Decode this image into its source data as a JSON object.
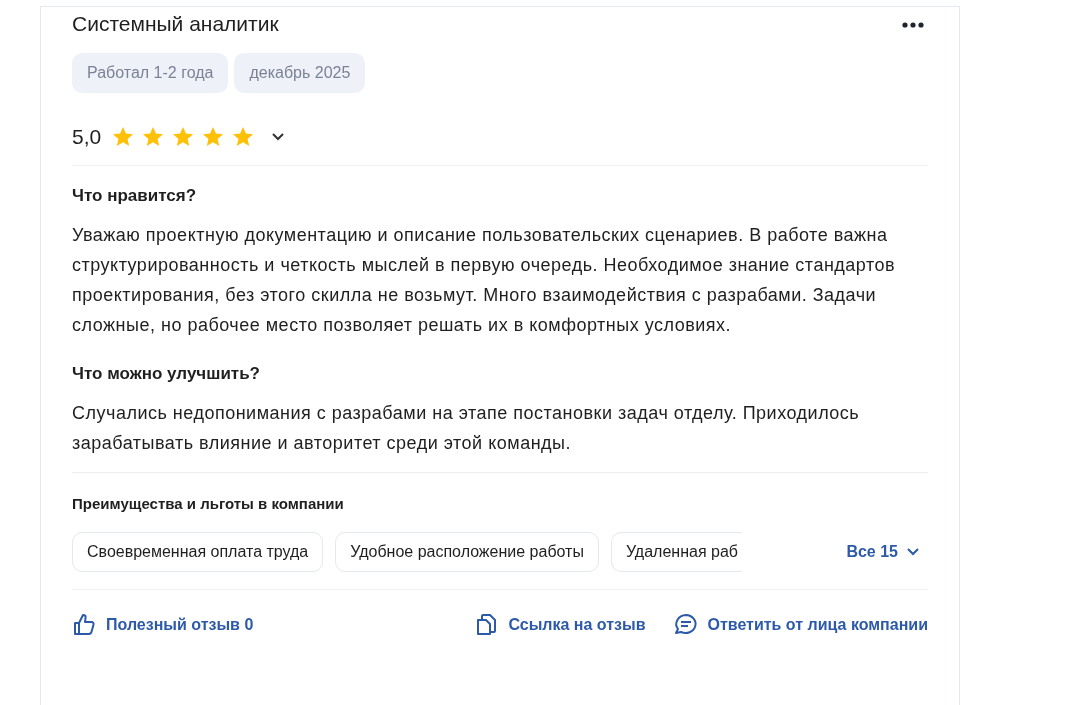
{
  "review": {
    "title": "Системный аналитик",
    "tags": [
      "Работал 1-2 года",
      "декабрь 2025"
    ],
    "rating": "5,0",
    "stars": 5,
    "sections": [
      {
        "heading": "Что нравится?",
        "text": "Уважаю проектную документацию и описание пользовательских сценариев. В работе важна структурированность и четкость мыслей в первую очередь. Необходимое знание стандартов проектирования, без этого скилла не возьмут. Много взаимодействия с разрабами. Задачи сложные, но рабочее место позволяет решать их в комфортных условиях."
      },
      {
        "heading": "Что можно улучшить?",
        "text": "Случались недопонимания с разрабами на этапе постановки задач отделу. Приходилось зарабатывать влияние и авторитет среди этой команды."
      }
    ],
    "benefits": {
      "heading": "Преимущества и льготы в компании",
      "items": [
        "Своевременная оплата труда",
        "Удобное расположение работы",
        "Удаленная раб"
      ],
      "all": "Все 15"
    },
    "actions": [
      {
        "kind": "like",
        "label": "Полезный отзыв 0"
      },
      {
        "kind": "link",
        "label": "Ссылка на отзыв"
      },
      {
        "kind": "reply",
        "label": "Ответить от лица компании"
      }
    ]
  }
}
